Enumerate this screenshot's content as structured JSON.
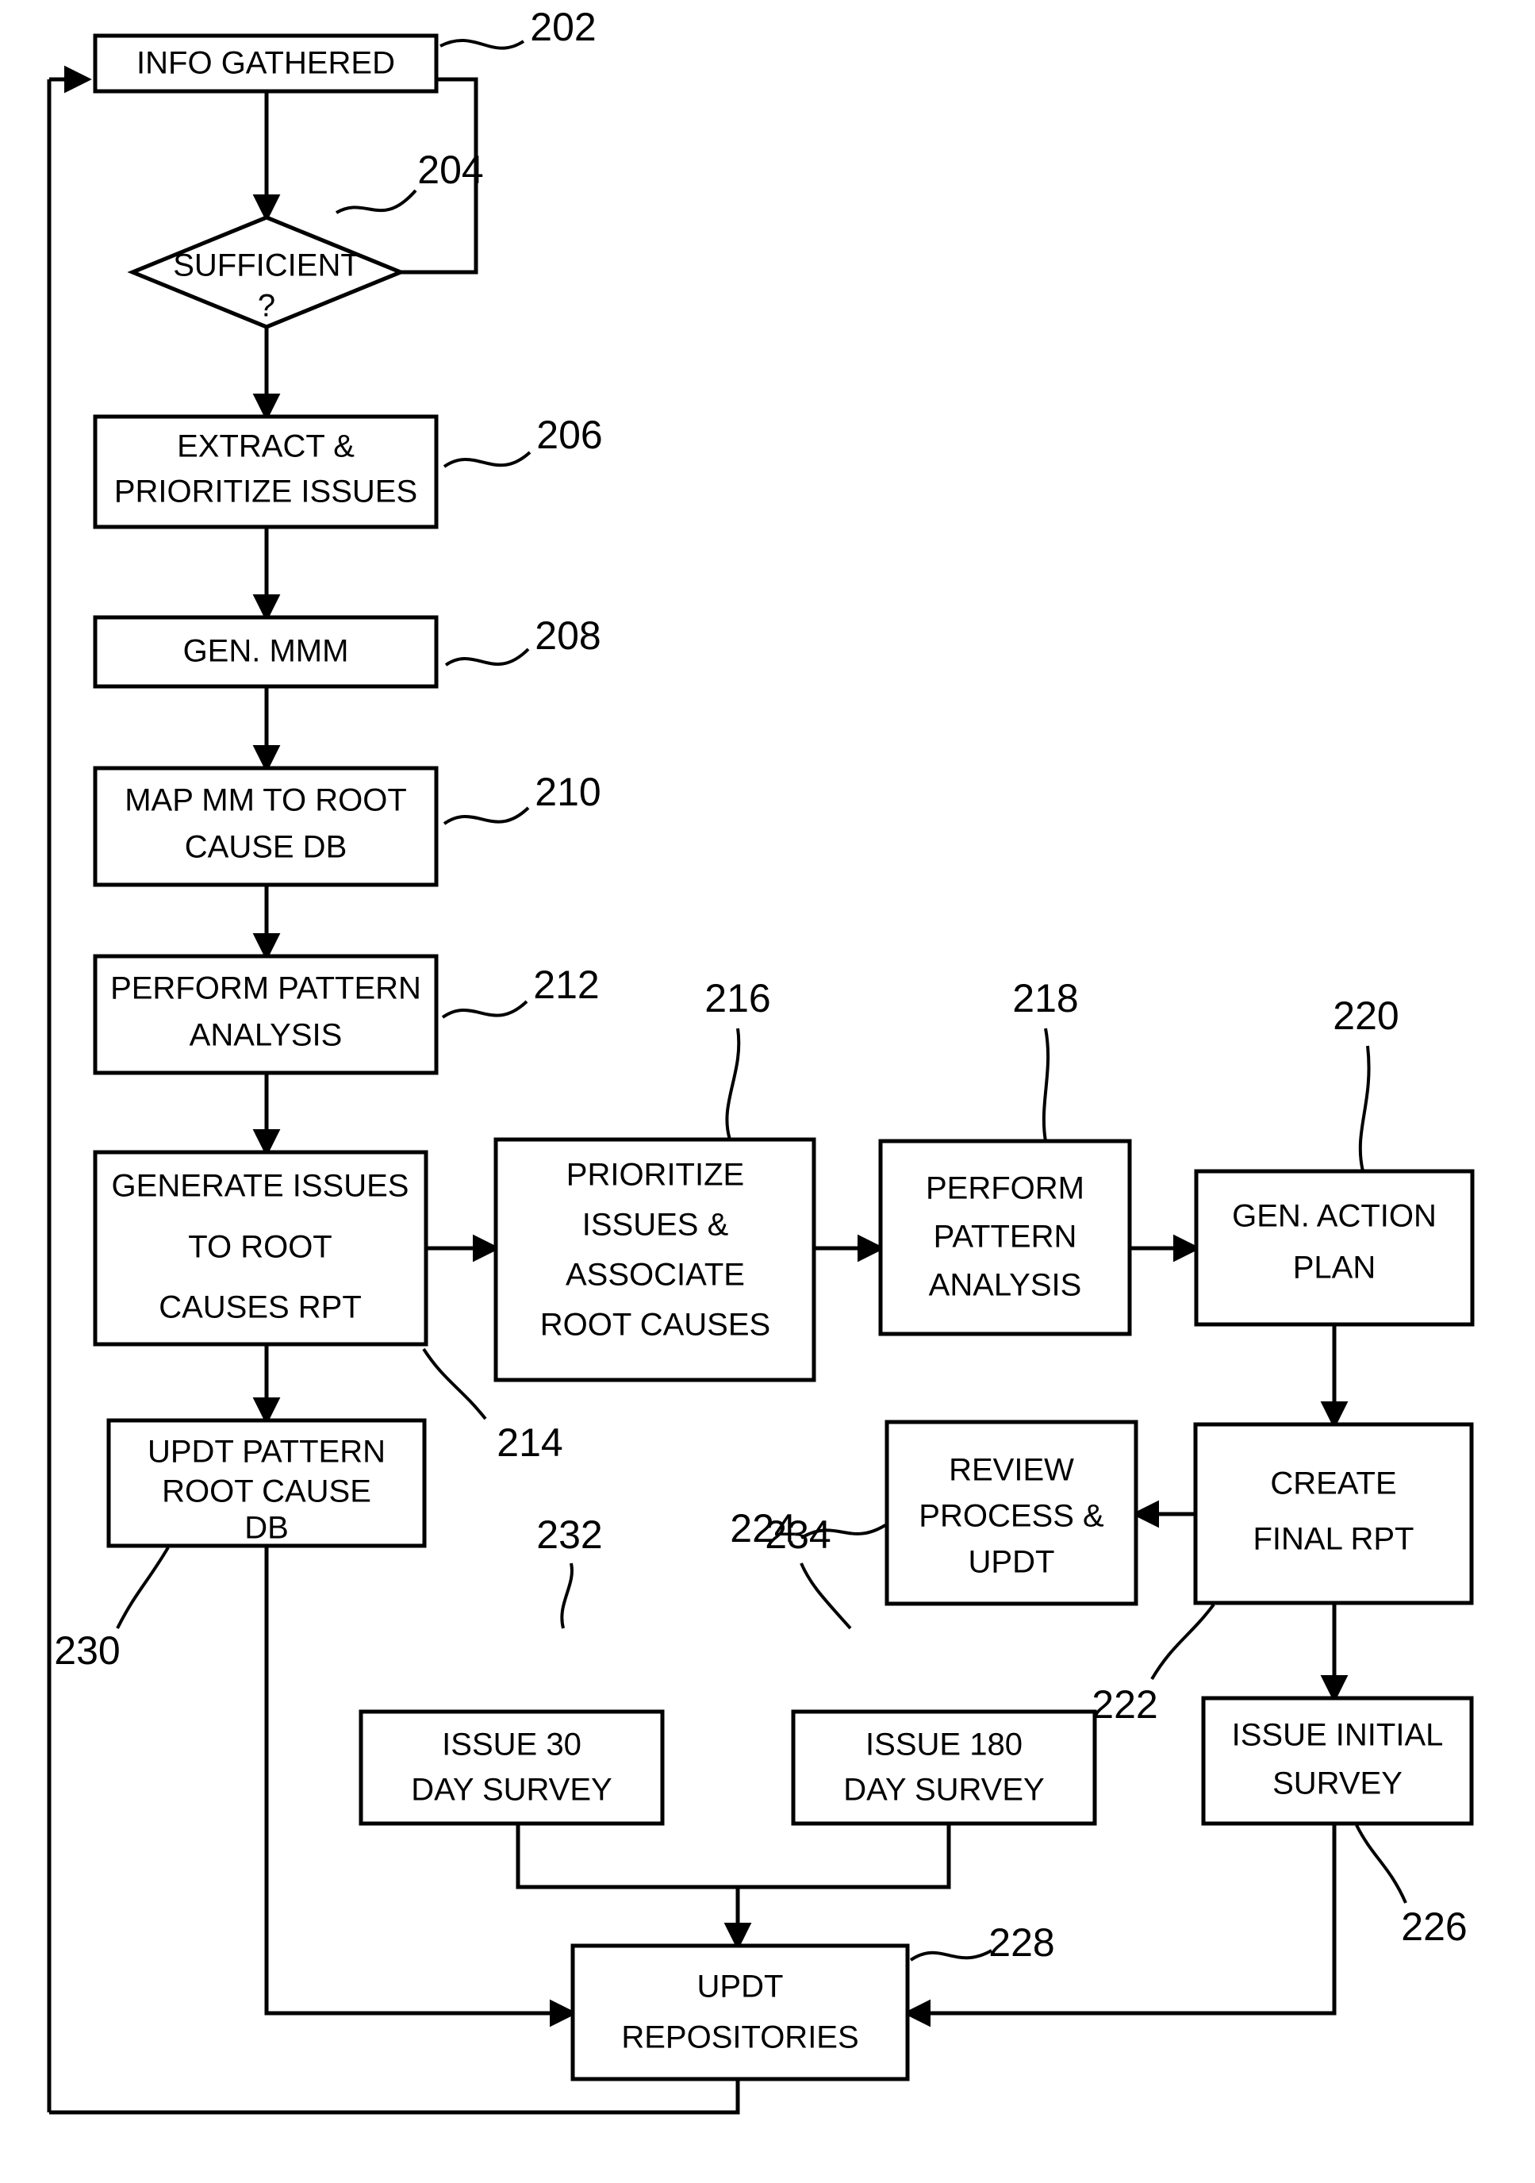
{
  "figure": {
    "type": "patent-flowchart",
    "title": "",
    "background": "#ffffff",
    "stroke": "#000000"
  },
  "nodes": {
    "info_gathered": {
      "ref": "202",
      "shape": "process",
      "lines": [
        "INFO GATHERED"
      ]
    },
    "sufficient": {
      "ref": "204",
      "shape": "decision",
      "lines": [
        "SUFFICIENT",
        "?"
      ]
    },
    "extract_prioritize": {
      "ref": "206",
      "shape": "process",
      "lines": [
        "EXTRACT &",
        "PRIORITIZE ISSUES"
      ]
    },
    "gen_mmm": {
      "ref": "208",
      "shape": "process",
      "lines": [
        "GEN. MMM"
      ]
    },
    "map_mm": {
      "ref": "210",
      "shape": "process",
      "lines": [
        "MAP MM TO ROOT",
        "CAUSE DB"
      ]
    },
    "perform_pattern_analysis_1": {
      "ref": "212",
      "shape": "process",
      "lines": [
        "PERFORM PATTERN",
        "ANALYSIS"
      ]
    },
    "generate_issues": {
      "ref": "214",
      "shape": "process",
      "lines": [
        "GENERATE ISSUES",
        "TO ROOT",
        "CAUSES RPT"
      ]
    },
    "prioritize_associate": {
      "ref": "216",
      "shape": "process",
      "lines": [
        "PRIORITIZE",
        "ISSUES &",
        "ASSOCIATE",
        "ROOT CAUSES"
      ]
    },
    "perform_pattern_analysis_2": {
      "ref": "218",
      "shape": "process",
      "lines": [
        "PERFORM",
        "PATTERN",
        "ANALYSIS"
      ]
    },
    "gen_action_plan": {
      "ref": "220",
      "shape": "process",
      "lines": [
        "GEN. ACTION",
        "PLAN"
      ]
    },
    "create_final_rpt": {
      "ref": "222",
      "shape": "process",
      "lines": [
        "CREATE",
        "FINAL RPT"
      ]
    },
    "review_process": {
      "ref": "224",
      "shape": "process",
      "lines": [
        "REVIEW",
        "PROCESS &",
        "UPDT"
      ]
    },
    "issue_initial_survey": {
      "ref": "226",
      "shape": "process",
      "lines": [
        "ISSUE INITIAL",
        "SURVEY"
      ]
    },
    "updt_repositories": {
      "ref": "228",
      "shape": "process",
      "lines": [
        "UPDT",
        "REPOSITORIES"
      ]
    },
    "updt_pattern_db": {
      "ref": "230",
      "shape": "process",
      "lines": [
        "UPDT PATTERN",
        "ROOT CAUSE",
        "DB"
      ]
    },
    "issue_30_day": {
      "ref": "232",
      "shape": "process",
      "lines": [
        "ISSUE 30",
        "DAY SURVEY"
      ]
    },
    "issue_180_day": {
      "ref": "234",
      "shape": "process",
      "lines": [
        "ISSUE 180",
        "DAY SURVEY"
      ]
    }
  },
  "ref_numbers": [
    "202",
    "204",
    "206",
    "208",
    "210",
    "212",
    "214",
    "216",
    "218",
    "220",
    "222",
    "224",
    "226",
    "228",
    "230",
    "232",
    "234"
  ],
  "text": {
    "info_gathered_l1": "INFO GATHERED",
    "sufficient_l1": "SUFFICIENT",
    "sufficient_l2": "?",
    "extract_l1": "EXTRACT &",
    "extract_l2": "PRIORITIZE ISSUES",
    "genmmm_l1": "GEN. MMM",
    "mapmm_l1": "MAP MM TO ROOT",
    "mapmm_l2": "CAUSE DB",
    "ppa1_l1": "PERFORM PATTERN",
    "ppa1_l2": "ANALYSIS",
    "genissues_l1": "GENERATE ISSUES",
    "genissues_l2": "TO ROOT",
    "genissues_l3": "CAUSES RPT",
    "prio_l1": "PRIORITIZE",
    "prio_l2": "ISSUES &",
    "prio_l3": "ASSOCIATE",
    "prio_l4": "ROOT CAUSES",
    "ppa2_l1": "PERFORM",
    "ppa2_l2": "PATTERN",
    "ppa2_l3": "ANALYSIS",
    "genaction_l1": "GEN. ACTION",
    "genaction_l2": "PLAN",
    "createfinal_l1": "CREATE",
    "createfinal_l2": "FINAL RPT",
    "review_l1": "REVIEW",
    "review_l2": "PROCESS &",
    "review_l3": "UPDT",
    "initsurvey_l1": "ISSUE INITIAL",
    "initsurvey_l2": "SURVEY",
    "updtrepo_l1": "UPDT",
    "updtrepo_l2": "REPOSITORIES",
    "updtpattern_l1": "UPDT PATTERN",
    "updtpattern_l2": "ROOT CAUSE",
    "updtpattern_l3": "DB",
    "issue30_l1": "ISSUE 30",
    "issue30_l2": "DAY SURVEY",
    "issue180_l1": "ISSUE 180",
    "issue180_l2": "DAY SURVEY",
    "ref_202": "202",
    "ref_204": "204",
    "ref_206": "206",
    "ref_208": "208",
    "ref_210": "210",
    "ref_212": "212",
    "ref_214": "214",
    "ref_216": "216",
    "ref_218": "218",
    "ref_220": "220",
    "ref_222": "222",
    "ref_224": "224",
    "ref_226": "226",
    "ref_228": "228",
    "ref_230": "230",
    "ref_232": "232",
    "ref_234": "234"
  }
}
